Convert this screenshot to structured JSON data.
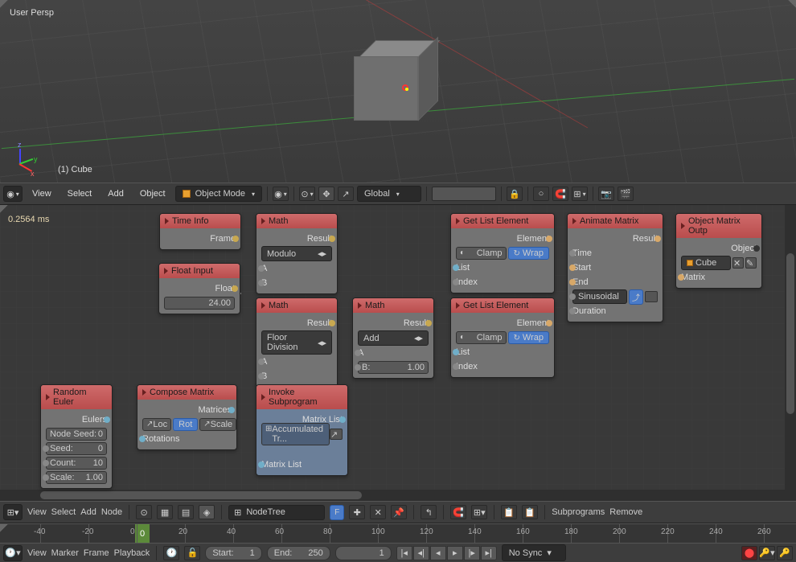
{
  "viewport": {
    "projection_label": "User Persp",
    "active_object": "(1) Cube"
  },
  "view3d_header": {
    "menus": [
      "View",
      "Select",
      "Add",
      "Object"
    ],
    "mode": "Object Mode",
    "orientation": "Global"
  },
  "node_editor": {
    "exec_time": "0.2564 ms",
    "header_menus": [
      "View",
      "Select",
      "Add",
      "Node"
    ],
    "tree_name": "NodeTree",
    "subprograms_label": "Subprograms",
    "remove_label": "Remove"
  },
  "nodes": {
    "time_info": {
      "title": "Time Info",
      "out_frame": "Frame"
    },
    "float_input": {
      "title": "Float Input",
      "out_float": "Float",
      "value": "24.00"
    },
    "math1": {
      "title": "Math",
      "out_result": "Result",
      "op": "Modulo",
      "in_a": "A",
      "in_b": "B"
    },
    "math2": {
      "title": "Math",
      "out_result": "Result",
      "op": "Floor Division",
      "in_a": "A",
      "in_b": "B"
    },
    "math3": {
      "title": "Math",
      "out_result": "Result",
      "op": "Add",
      "in_a": "A",
      "in_b_label": "B:",
      "in_b_val": "1.00"
    },
    "get_elem1": {
      "title": "Get List Element",
      "out_element": "Element",
      "clamp": "Clamp",
      "wrap": "Wrap",
      "in_list": "List",
      "in_index": "Index"
    },
    "get_elem2": {
      "title": "Get List Element",
      "out_element": "Element",
      "clamp": "Clamp",
      "wrap": "Wrap",
      "in_list": "List",
      "in_index": "Index"
    },
    "animate_matrix": {
      "title": "Animate Matrix",
      "out_result": "Result",
      "in_time": "Time",
      "in_start": "Start",
      "in_end": "End",
      "interpolation": "Sinusoidal",
      "in_duration": "Duration"
    },
    "object_output": {
      "title": "Object Matrix Outp",
      "in_object": "Object",
      "object_name": "Cube",
      "in_matrix": "Matrix"
    },
    "random_euler": {
      "title": "Random Euler",
      "out_eulers": "Eulers",
      "node_seed_label": "Node Seed:",
      "node_seed": "0",
      "seed_label": "Seed:",
      "seed": "0",
      "count_label": "Count:",
      "count": "10",
      "scale_label": "Scale:",
      "scale": "1.00"
    },
    "compose_matrix": {
      "title": "Compose Matrix",
      "out_matrices": "Matrices",
      "loc": "Loc",
      "rot": "Rot",
      "scale": "Scale",
      "in_rotations": "Rotations"
    },
    "invoke_sub": {
      "title": "Invoke Subprogram",
      "out_matrix_list": "Matrix List",
      "subprogram": "Accumulated Tr...",
      "in_matrix_list": "Matrix List"
    }
  },
  "timeline": {
    "ticks": [
      "-40",
      "-20",
      "0",
      "20",
      "40",
      "60",
      "80",
      "100",
      "120",
      "140",
      "160",
      "180",
      "200",
      "220",
      "240",
      "260"
    ],
    "current_frame": "0",
    "header_menus": [
      "View",
      "Marker",
      "Frame",
      "Playback"
    ],
    "start_label": "Start:",
    "start": "1",
    "end_label": "End:",
    "end": "250",
    "current": "1",
    "sync": "No Sync"
  }
}
